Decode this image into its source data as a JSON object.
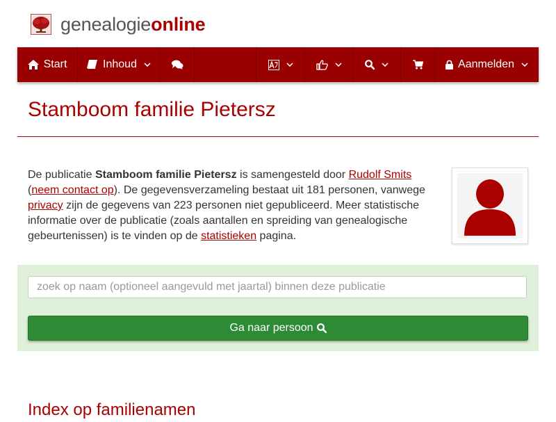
{
  "brand": {
    "part1": "genealogie",
    "part2": "online"
  },
  "nav": {
    "start_label": "Start",
    "inhoud_label": "Inhoud",
    "login_label": "Aanmelden",
    "icons": [
      "home-icon",
      "book-icon",
      "comments-icon",
      "language-icon",
      "thumbs-up-icon",
      "search-icon",
      "cart-icon",
      "lock-icon"
    ]
  },
  "page": {
    "title": "Stamboom familie Pietersz"
  },
  "intro": {
    "t1": "De publicatie ",
    "pub_name": "Stamboom familie Pietersz",
    "t2": " is samengesteld door ",
    "author_link": "Rudolf Smits",
    "t3": " (",
    "contact_link": "neem contact op",
    "t4": "). De gegevensverzameling bestaat uit 181 personen, vanwege ",
    "privacy_link": "privacy",
    "t5": " zijn de gegevens van 223 personen niet gepubliceerd. Meer statistische informatie over de publicatie (zoals aantallen en spreiding van genealogische gebeurtenissen) is te vinden op de ",
    "stats_link": "statistieken",
    "t6": " pagina."
  },
  "search": {
    "placeholder": "zoek op naam (optioneel aangevuld met jaartal) binnen deze publicatie",
    "value": "",
    "button_label": "Ga naar persoon"
  },
  "section": {
    "index_heading": "Index op familienamen"
  },
  "colors": {
    "brand_red": "#990000",
    "title_red": "#aa0000",
    "panel_green": "#dff0d8",
    "button_green": "#2d8a35"
  }
}
